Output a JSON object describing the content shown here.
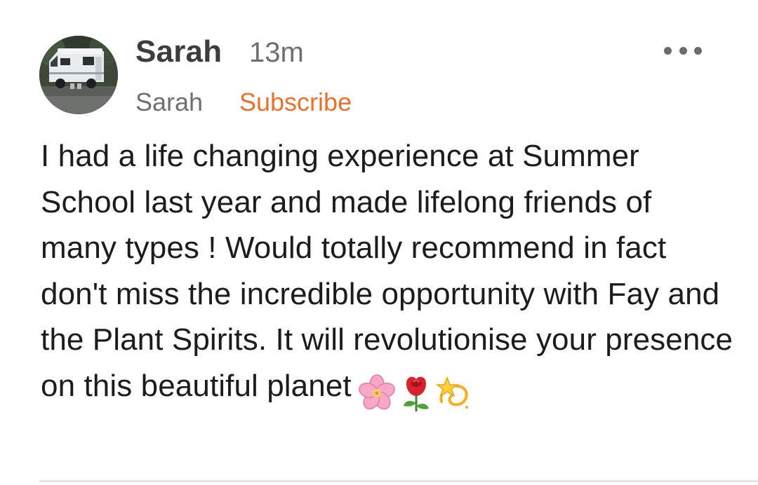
{
  "comment": {
    "author": "Sarah",
    "timestamp": "13m",
    "publication": "Sarah",
    "subscribe_label": "Subscribe",
    "body": "I had a life changing experience at Summer School last year and made lifelong friends of many types ! Would totally recommend in fact don't miss the incredible opportunity with Fay and the Plant Spirits. It will revolutionise your presence on this beautiful planet",
    "emojis": [
      "cherry-blossom",
      "rose",
      "dizzy"
    ]
  },
  "colors": {
    "subscribe": "#e8712b",
    "author": "#3d3d3d",
    "meta": "#6f6f6f",
    "body": "#1c1c1c"
  },
  "icons": {
    "more": "more-options-icon",
    "avatar": "campervan-photo"
  }
}
